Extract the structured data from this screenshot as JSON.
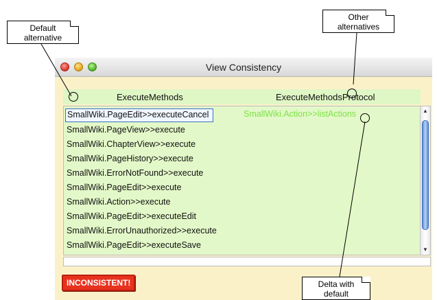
{
  "window": {
    "title": "View Consistency"
  },
  "columns": {
    "left": "ExecuteMethods",
    "right": "ExecuteMethodsProtocol"
  },
  "methods": [
    "SmallWiki.PageEdit>>executeCancel",
    "SmallWiki.PageView>>execute",
    "SmallWiki.ChapterView>>execute",
    "SmallWiki.PageHistory>>execute",
    "SmallWiki.ErrorNotFound>>execute",
    "SmallWiki.PageEdit>>execute",
    "SmallWiki.Action>>execute",
    "SmallWiki.PageEdit>>executeEdit",
    "SmallWiki.ErrorUnauthorized>>execute",
    "SmallWiki.PageEdit>>executeSave"
  ],
  "delta_method": "SmallWiki.Action>>listActions",
  "status": "INCONSISTENT!",
  "notes": {
    "default_line1": "Default",
    "default_line2": "alternative",
    "other_line1": "Other",
    "other_line2": "alternatives",
    "delta_line1": "Delta with",
    "delta_line2": "default"
  },
  "colors": {
    "delta": "#7ee14a",
    "status": "#e8321e",
    "panel": "#e3f8c8"
  }
}
